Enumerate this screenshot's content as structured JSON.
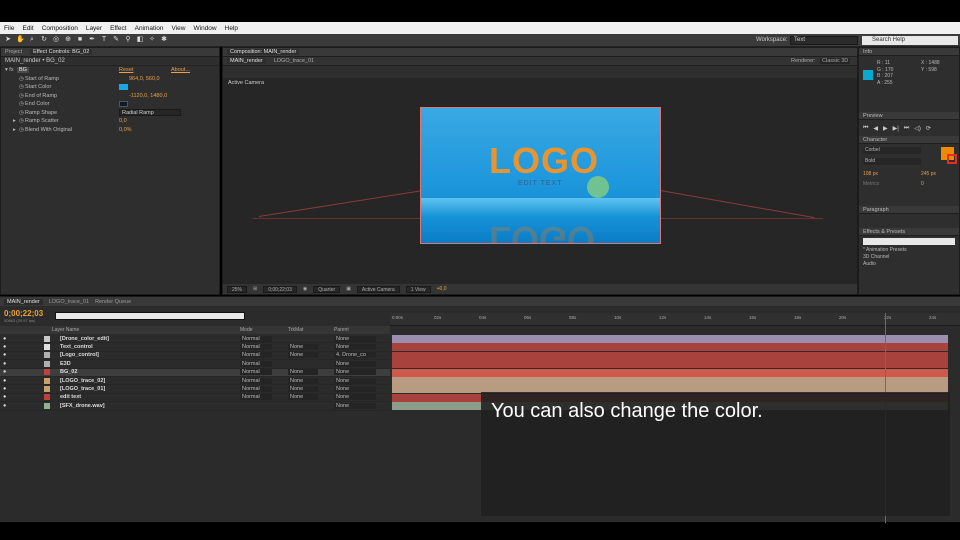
{
  "menu": [
    "File",
    "Edit",
    "Composition",
    "Layer",
    "Effect",
    "Animation",
    "View",
    "Window",
    "Help"
  ],
  "toolbar": {
    "workspace_label": "Workspace:",
    "workspace_value": "Text",
    "search_placeholder": "Search Help"
  },
  "left_panel": {
    "tabs": [
      "Project",
      "Effect Controls: BG_02"
    ],
    "title": "MAIN_render • BG_02",
    "effect_name": "BG",
    "reset": "Reset",
    "about": "About...",
    "properties": [
      {
        "label": "Start of Ramp",
        "value": "964,0, 560,0"
      },
      {
        "label": "Start Color",
        "value": ""
      },
      {
        "label": "End of Ramp",
        "value": "-1120,0, 1480,0"
      },
      {
        "label": "End Color",
        "value": ""
      },
      {
        "label": "Ramp Shape",
        "value": "Radial Ramp"
      },
      {
        "label": "Ramp Scatter",
        "value": "0,0"
      },
      {
        "label": "Blend With Original",
        "value": "0,0%"
      }
    ],
    "colors": {
      "start": "#1aa7e8",
      "end": "#0b1a2e"
    }
  },
  "comp_panel": {
    "tab": "Composition: MAIN_render",
    "sub_tabs": [
      "MAIN_render",
      "LOGO_trace_01"
    ],
    "renderer_label": "Renderer:",
    "renderer_value": "Classic 3D",
    "view_label": "Active Camera",
    "logo_text": "LOGO",
    "edit_text": "EDIT TEXT",
    "footer": {
      "zoom": "25%",
      "timecode": "0;00;22;03",
      "resolution": "Quarter",
      "camera": "Active Camera",
      "views": "1 View",
      "exposure": "+0,0"
    }
  },
  "right_panel": {
    "info": {
      "title": "Info",
      "r": "R : 11",
      "g": "G : 170",
      "b": "B : 207",
      "a": "A : 255",
      "x": "X : 1488",
      "y": "Y : 598"
    },
    "preview_title": "Preview",
    "character": {
      "title": "Character",
      "font": "Corbel",
      "style": "Bold",
      "size": "108 px",
      "leading": "245 px",
      "tracking": "Metrics",
      "kerning": "0"
    },
    "paragraph_title": "Paragraph",
    "effects": {
      "title": "Effects & Presets",
      "items": [
        "* Animation Presets",
        "3D Channel",
        "Audio"
      ]
    }
  },
  "timeline": {
    "tabs": [
      "MAIN_render",
      "LOGO_trace_01",
      "Render Queue"
    ],
    "timecode": "0;00;22;03",
    "fps": "00663 (29.97 fps)",
    "columns": {
      "layer_name": "Layer Name",
      "mode": "Mode",
      "trkmat": "TrkMat",
      "parent": "Parent"
    },
    "ruler": [
      "0:00s",
      "02s",
      "04s",
      "06s",
      "08s",
      "10s",
      "12s",
      "14s",
      "16s",
      "18s",
      "20s",
      "22s",
      "24s"
    ],
    "layers": [
      {
        "num": "1",
        "name": "[Drone_color_edit]",
        "mode": "Normal",
        "trk": "",
        "parent": "None",
        "color": "#c8c8c8",
        "bar": "#9b8fb0"
      },
      {
        "num": "2",
        "name": "Text_control",
        "mode": "Normal",
        "trk": "None",
        "parent": "None",
        "color": "#e0e0e0",
        "bar": "#a7433c"
      },
      {
        "num": "3",
        "name": "[Logo_control]",
        "mode": "Normal",
        "trk": "None",
        "parent": "4. Drone_co",
        "color": "#b0b0b0",
        "bar": "#a7433c"
      },
      {
        "num": "4",
        "name": "E3D",
        "mode": "Normal",
        "trk": "",
        "parent": "None",
        "color": "#b0b0b0",
        "bar": "#a7433c"
      },
      {
        "num": "5",
        "name": "BG_02",
        "mode": "Normal",
        "trk": "None",
        "parent": "None",
        "color": "#c24040",
        "bar": "#d0594d"
      },
      {
        "num": "6",
        "name": "[LOGO_trace_02]",
        "mode": "Normal",
        "trk": "None",
        "parent": "None",
        "color": "#c8a070",
        "bar": "#b89b80"
      },
      {
        "num": "7",
        "name": "[LOGO_trace_01]",
        "mode": "Normal",
        "trk": "None",
        "parent": "None",
        "color": "#c8a070",
        "bar": "#b89b80"
      },
      {
        "num": "8",
        "name": "edit text",
        "mode": "Normal",
        "trk": "None",
        "parent": "None",
        "color": "#c04040",
        "bar": "#a7433c"
      },
      {
        "num": "9",
        "name": "[SFX_drone.wav]",
        "mode": "",
        "trk": "",
        "parent": "None",
        "color": "#90b090",
        "bar": "#8c9e8a"
      }
    ]
  },
  "subtitle": "You can also change the color."
}
